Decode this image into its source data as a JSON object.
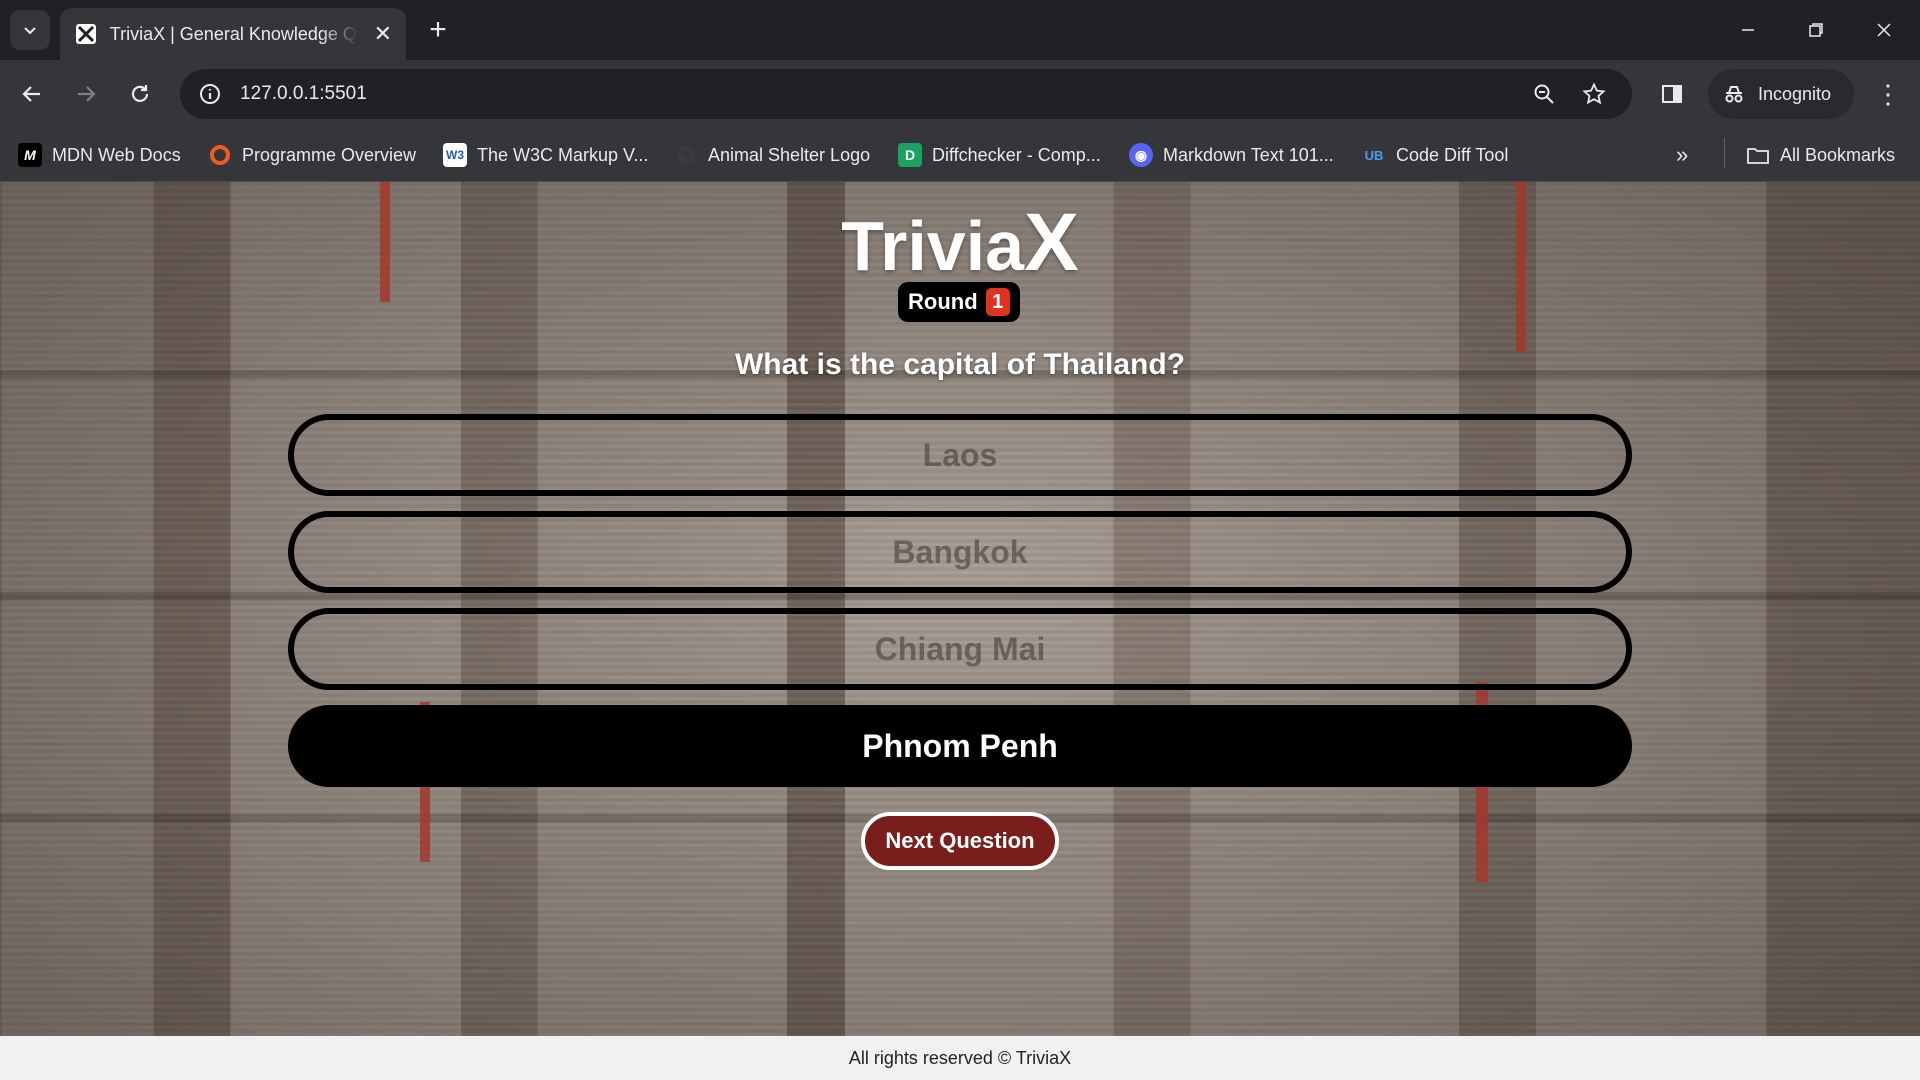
{
  "browser": {
    "tab_title": "TriviaX | General Knowledge Quiz",
    "url": "127.0.0.1:5501",
    "incognito_label": "Incognito",
    "bookmarks": [
      {
        "label": "MDN Web Docs",
        "icon": "mdn-icon"
      },
      {
        "label": "Programme Overview",
        "icon": "orange-circle-icon"
      },
      {
        "label": "The W3C Markup V...",
        "icon": "w3c-icon"
      },
      {
        "label": "Animal Shelter Logo",
        "icon": "github-icon"
      },
      {
        "label": "Diffchecker - Comp...",
        "icon": "diffchecker-icon"
      },
      {
        "label": "Markdown Text 101...",
        "icon": "discord-icon"
      },
      {
        "label": "Code Diff Tool",
        "icon": "code-diff-icon"
      }
    ],
    "all_bookmarks_label": "All Bookmarks"
  },
  "quiz": {
    "logo_main": "Trivia",
    "logo_x": "X",
    "round_label": "Round",
    "round_number": "1",
    "question": "What is the capital of Thailand?",
    "answers": [
      "Laos",
      "Bangkok",
      "Chiang Mai",
      "Phnom Penh"
    ],
    "selected_answer_index": 3,
    "next_label": "Next Question"
  },
  "footer": {
    "text": "All rights reserved © TriviaX"
  },
  "colors": {
    "accent_red": "#7a1e1b",
    "round_badge_red": "#e0321f",
    "selected_answer_bg": "#000000"
  }
}
